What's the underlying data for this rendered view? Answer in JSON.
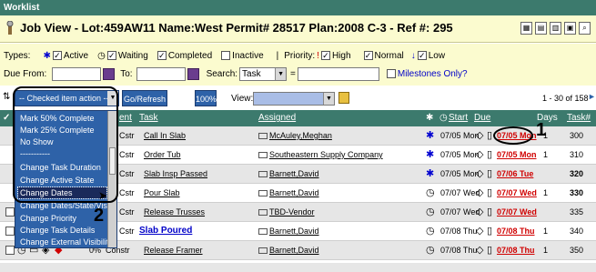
{
  "window": {
    "title": "Worklist"
  },
  "header": {
    "job_title": "Job View - Lot:459AW11 Name:West Permit# 28517 Plan:2008 C-3 - Ref #: 295",
    "icons": [
      "map-icon",
      "note-icon",
      "calendar-icon",
      "print-icon",
      "search-icon"
    ]
  },
  "filters": {
    "types_label": "Types:",
    "types": [
      {
        "label": "Active",
        "checked": true
      },
      {
        "label": "Waiting",
        "checked": true
      },
      {
        "label": "Completed",
        "checked": true
      },
      {
        "label": "Inactive",
        "checked": false
      }
    ],
    "priority_label": "Priority:",
    "priorities": [
      {
        "label": "High",
        "checked": true
      },
      {
        "label": "Normal",
        "checked": true
      },
      {
        "label": "Low",
        "checked": true
      }
    ],
    "due_from_label": "Due From:",
    "due_from_value": "",
    "to_label": "To:",
    "to_value": "",
    "search_label": "Search:",
    "search_field": "Task",
    "search_op": "=",
    "search_value": "",
    "milestones_label": "Milestones Only?"
  },
  "toolbar": {
    "action_select": "-- Checked item action --",
    "go_refresh": "Go/Refresh",
    "zoom": "100%",
    "view_label": "View:",
    "view_value": "",
    "pager": "1 - 30 of 158"
  },
  "dropdown": {
    "items": [
      "Mark 50% Complete",
      "Mark 25% Complete",
      "No Show",
      "-----------",
      "Change Task Duration",
      "Change Active State",
      "Change Dates",
      "Change Dates/State/Visib",
      "Change Priority",
      "Change Task Details",
      "Change External Visibility"
    ],
    "selected": "Change Dates"
  },
  "table": {
    "headers": {
      "ent": "ent",
      "task": "Task",
      "assigned": "Assigned",
      "start": "Start",
      "due": "Due",
      "days": "Days",
      "tasknum": "Task#"
    },
    "rows": [
      {
        "ent": "Cstr",
        "task": "Call In Slab",
        "assigned": "McAuley,Meghan",
        "start": "07/05 Mon",
        "due": "07/05 Mon",
        "days": "1",
        "tasknum": "300",
        "state": "active"
      },
      {
        "ent": "Cstr",
        "task": "Order Tub",
        "assigned": "Southeastern Supply Company",
        "start": "07/05 Mon",
        "due": "07/05 Mon",
        "days": "1",
        "tasknum": "310",
        "state": "active"
      },
      {
        "ent": "Cstr",
        "task": "Slab Insp Passed",
        "assigned": "Barnett,David",
        "start": "07/05 Mon",
        "due": "07/06 Tue",
        "days": "",
        "tasknum": "320",
        "state": "active"
      },
      {
        "ent": "Cstr",
        "task": "Pour Slab",
        "assigned": "Barnett,David",
        "start": "07/07 Wed",
        "due": "07/07 Wed",
        "days": "1",
        "tasknum": "330",
        "state": "waiting"
      },
      {
        "ent": "Cstr",
        "task": "Release Trusses",
        "assigned": "TBD-Vendor",
        "start": "07/07 Wed",
        "due": "07/07 Wed",
        "days": "",
        "tasknum": "335",
        "state": "waiting"
      },
      {
        "ent": "Cstr",
        "task": "Slab Poured",
        "assigned": "Barnett,David",
        "start": "07/08 Thu",
        "due": "07/08 Thu",
        "days": "1",
        "tasknum": "340",
        "state": "waiting"
      },
      {
        "pct": "0%",
        "ent": "Constr",
        "task": "Release Framer",
        "assigned": "Barnett,David",
        "start": "07/08 Thu",
        "due": "07/08 Thu",
        "days": "1",
        "tasknum": "350",
        "state": "waiting"
      }
    ]
  },
  "annotations": {
    "one": "1",
    "two": "2"
  },
  "colors": {
    "title_bar": "#3c7a6d",
    "header_bg": "#fbfbcf",
    "button_blue": "#2e62a8",
    "due_red": "#d00000"
  }
}
